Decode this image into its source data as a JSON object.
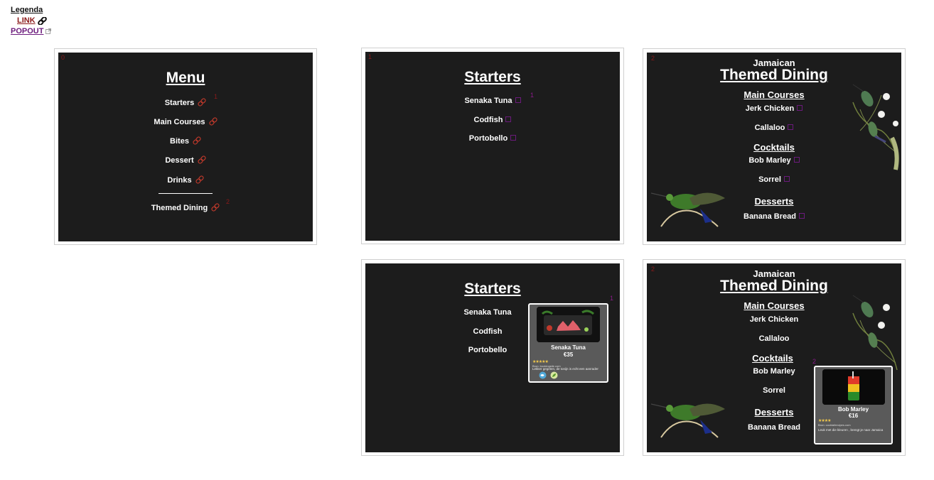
{
  "legend": {
    "title": "Legenda",
    "link": "LINK",
    "popout": "POPOUT"
  },
  "menu": {
    "number": "0",
    "title": "Menu",
    "items": [
      {
        "label": "Starters",
        "num": "1"
      },
      {
        "label": "Main Courses"
      },
      {
        "label": "Bites"
      },
      {
        "label": "Dessert"
      },
      {
        "label": "Drinks"
      },
      {
        "label": "Themed Dining",
        "num": "2"
      }
    ]
  },
  "starters": {
    "number": "1",
    "title": "Starters",
    "items": [
      "Senaka Tuna",
      "Codfish",
      "Portobello"
    ],
    "popout_num": "1"
  },
  "themed": {
    "number": "2",
    "subtitle": "Jamaican",
    "title": "Themed Dining",
    "sections": [
      {
        "heading": "Main Courses",
        "items": [
          "Jerk Chicken",
          "Callaloo"
        ]
      },
      {
        "heading": "Cocktails",
        "items": [
          "Bob Marley",
          "Sorrel"
        ]
      },
      {
        "heading": "Desserts",
        "items": [
          "Banana Bread"
        ]
      }
    ],
    "popout_num": "2"
  },
  "tuna_card": {
    "name": "Senaka Tuna",
    "price": "€35",
    "stars": "★★★★★",
    "small": "Bron: bookingsite.com",
    "review": "Lekker gegeten, de tonijn is echt een aanrader"
  },
  "marley_card": {
    "name": "Bob Marley",
    "price": "€16",
    "stars": "★★★★",
    "small": "Bron: cocktailrecipes.com",
    "review": "Leuk met die kleuren , brengt je naar Jamaica"
  },
  "colors": {
    "screen_bg": "#1c1c1c",
    "link_red": "#c0392b",
    "popout_purple": "#6b1a7c"
  }
}
